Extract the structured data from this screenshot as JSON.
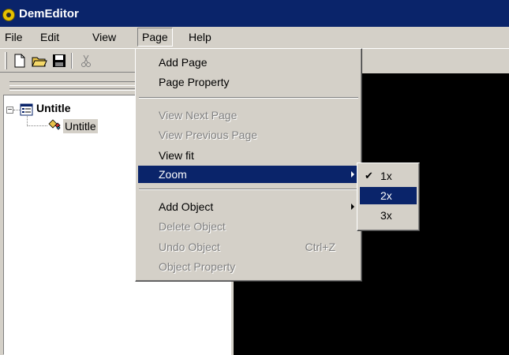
{
  "window": {
    "title": "DemEditor"
  },
  "menubar": {
    "items": [
      {
        "label": "File"
      },
      {
        "label": "Edit"
      },
      {
        "label": "View"
      },
      {
        "label": "Page"
      },
      {
        "label": "Help"
      }
    ]
  },
  "toolbar": {
    "buttons": [
      {
        "icon": "new-document-icon"
      },
      {
        "icon": "open-folder-icon"
      },
      {
        "icon": "save-disk-icon"
      },
      {
        "icon": "cut-scissors-icon"
      }
    ]
  },
  "tree": {
    "root": {
      "label": "Untitle"
    },
    "child": {
      "label": "Untitle"
    }
  },
  "page_menu": {
    "items": [
      {
        "label": "Add Page",
        "enabled": true
      },
      {
        "label": "Page Property",
        "enabled": true
      },
      {
        "label": "View Next Page",
        "enabled": false
      },
      {
        "label": "View Previous Page",
        "enabled": false
      },
      {
        "label": "View fit",
        "enabled": true
      },
      {
        "label": "Zoom",
        "enabled": true,
        "submenu": true,
        "highlighted": true
      },
      {
        "label": "Add Object",
        "enabled": true,
        "submenu": true
      },
      {
        "label": "Delete Object",
        "enabled": false
      },
      {
        "label": "Undo Object",
        "enabled": false,
        "shortcut": "Ctrl+Z"
      },
      {
        "label": "Object Property",
        "enabled": false
      }
    ]
  },
  "zoom_menu": {
    "items": [
      {
        "label": "1x",
        "checked": true
      },
      {
        "label": "2x",
        "highlighted": true
      },
      {
        "label": "3x"
      }
    ]
  },
  "colors": {
    "title_bar": "#0a246a",
    "menu_highlight": "#0a246a",
    "canvas": "#000000",
    "chrome": "#d4d0c8"
  }
}
